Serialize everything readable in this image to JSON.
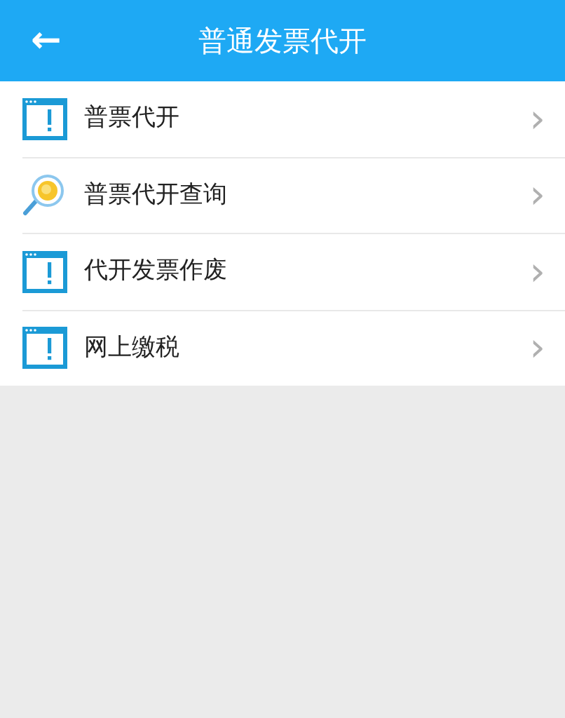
{
  "header": {
    "back": "←",
    "title": "普通发票代开"
  },
  "menu": [
    {
      "kind": "window",
      "label": "普票代开",
      "chevron": "›"
    },
    {
      "kind": "search",
      "label": "普票代开查询",
      "chevron": "›"
    },
    {
      "kind": "window",
      "label": "代开发票作废",
      "chevron": "›"
    },
    {
      "kind": "window",
      "label": "网上缴税",
      "chevron": "›"
    }
  ]
}
